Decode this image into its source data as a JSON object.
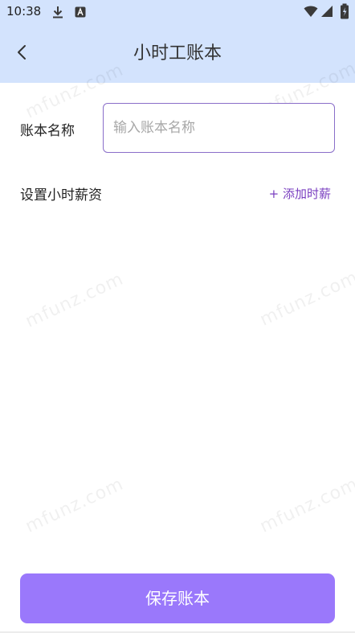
{
  "statusbar": {
    "time": "10:38"
  },
  "appbar": {
    "title": "小时工账本",
    "back_icon": "chevron-left-icon"
  },
  "form": {
    "name_label": "账本名称",
    "name_input_value": "",
    "name_input_placeholder": "输入账本名称",
    "wage_label": "设置小时薪资",
    "add_wage_label": "+ 添加时薪"
  },
  "footer": {
    "save_label": "保存账本"
  },
  "watermark": {
    "text": "mfunz.com"
  },
  "colors": {
    "header_bg": "#d3e3fd",
    "accent": "#7a3fc0",
    "input_border": "#8a6ec9",
    "save_button_bg": "#9a78fb"
  }
}
